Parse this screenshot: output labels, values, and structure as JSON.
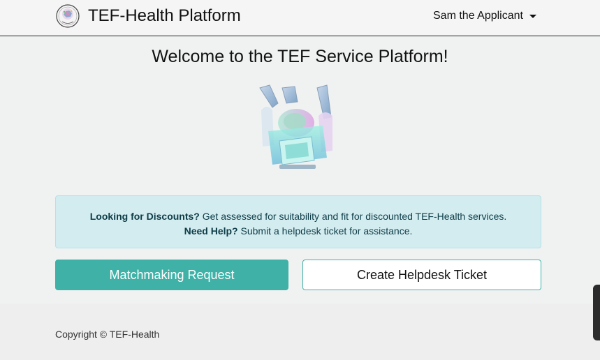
{
  "navbar": {
    "title": "TEF-Health Platform",
    "user_name": "Sam the Applicant"
  },
  "main": {
    "welcome": "Welcome to the TEF Service Platform!",
    "info": {
      "line1_bold": "Looking for Discounts?",
      "line1_text": " Get assessed for suitability and fit for discounted TEF-Health services.",
      "line2_bold": "Need Help?",
      "line2_text": " Submit a helpdesk ticket for assistance."
    },
    "buttons": {
      "matchmaking": "Matchmaking Request",
      "helpdesk": "Create Helpdesk Ticket"
    }
  },
  "footer": {
    "copyright": "Copyright © TEF-Health"
  },
  "colors": {
    "accent": "#3fb1a7",
    "info_bg": "#d3ecf0",
    "info_text": "#0d3c47"
  },
  "icons": {
    "logo": "tef-health-logo",
    "user_dropdown": "caret-down-icon",
    "hero": "robotic-surgery-illustration"
  }
}
